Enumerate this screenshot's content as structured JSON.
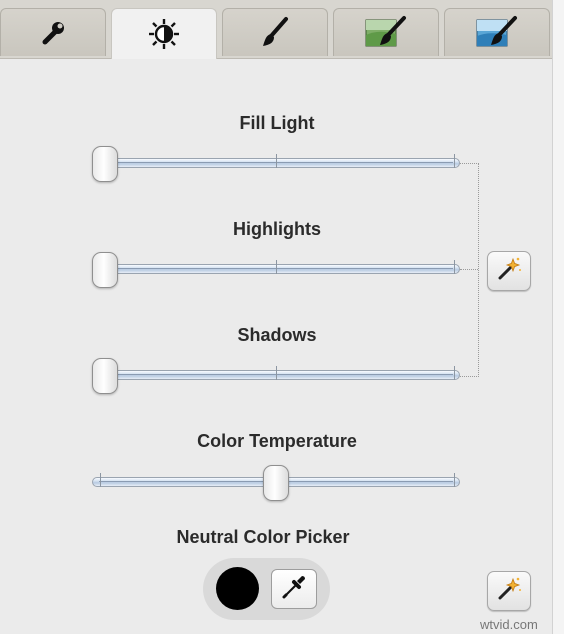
{
  "tabs": [
    {
      "name": "adjust-tab",
      "icon": "wrench-icon"
    },
    {
      "name": "exposure-tab",
      "icon": "brightness-icon",
      "active": true
    },
    {
      "name": "brush-tab",
      "icon": "brush-icon"
    },
    {
      "name": "green-brush-tab",
      "icon": "green-landscape-brush-icon"
    },
    {
      "name": "blue-brush-tab",
      "icon": "blue-landscape-brush-icon"
    }
  ],
  "controls": {
    "fill_light": {
      "label": "Fill Light",
      "value": 0.0
    },
    "highlights": {
      "label": "Highlights",
      "value": 0.0
    },
    "shadows": {
      "label": "Shadows",
      "value": 0.0
    },
    "color_temperature": {
      "label": "Color Temperature",
      "value": 0.5
    },
    "neutral_picker": {
      "label": "Neutral Color Picker",
      "swatch_color": "#000000"
    }
  },
  "colors": {
    "panel_bg": "#ebebeb",
    "active_tab": "#f1f1f1",
    "track_blue": "#b8cbe2"
  },
  "watermark": "wtvid.com"
}
